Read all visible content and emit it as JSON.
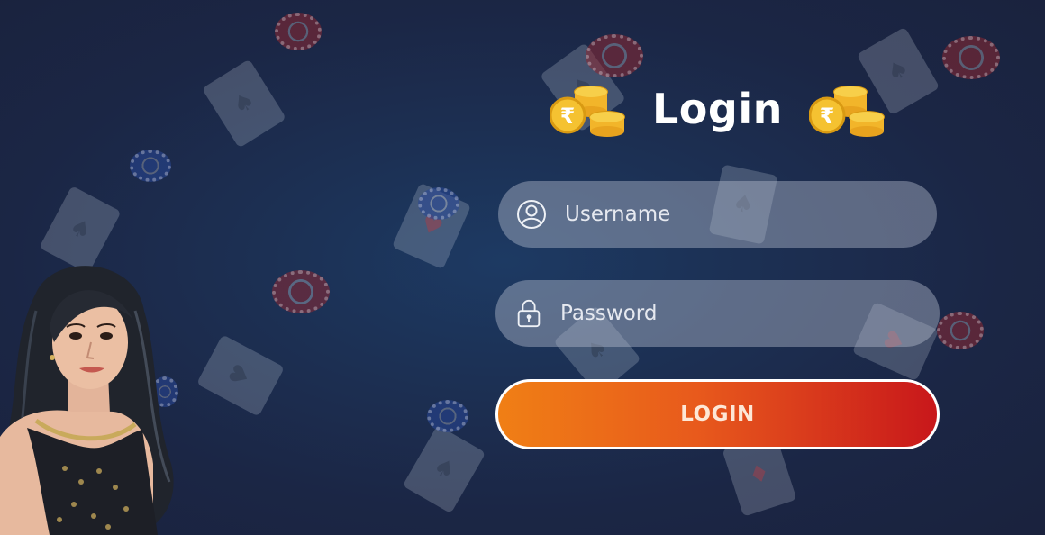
{
  "login_form": {
    "title": "Login",
    "username": {
      "placeholder": "Username",
      "value": "",
      "icon": "user-icon"
    },
    "password": {
      "placeholder": "Password",
      "value": "",
      "icon": "padlock-icon"
    },
    "submit_label": "LOGIN"
  },
  "decorations": {
    "coin_icon": "rupee-coin-stack-icon",
    "coin_symbol": "₹",
    "character": "character-illustration"
  },
  "colors": {
    "background": "#1b2645",
    "button_start": "#f07f15",
    "button_end": "#c8171b",
    "coin": "#f5c231"
  }
}
